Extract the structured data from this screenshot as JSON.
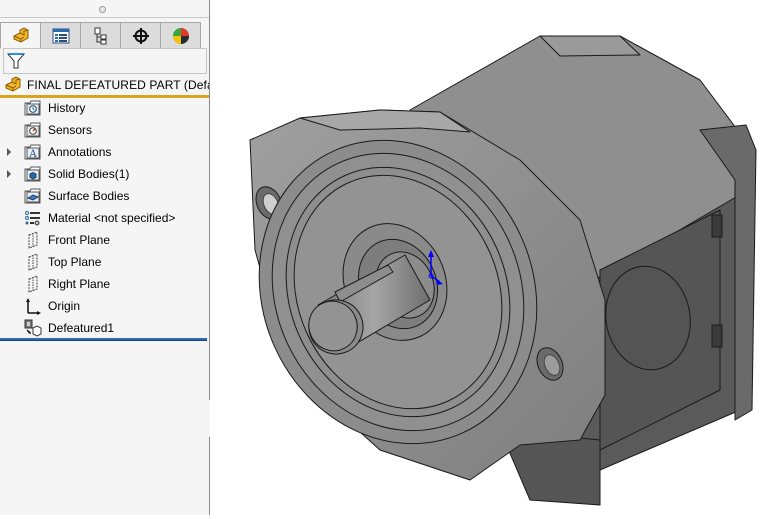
{
  "feature_manager": {
    "tabs": [
      {
        "name": "FeatureManager Design Tree",
        "icon": "part-icon",
        "active": true
      },
      {
        "name": "PropertyManager",
        "icon": "property-manager-icon",
        "active": false
      },
      {
        "name": "ConfigurationManager",
        "icon": "configuration-manager-icon",
        "active": false
      },
      {
        "name": "DimXpertManager",
        "icon": "dimxpert-icon",
        "active": false
      },
      {
        "name": "DisplayManager",
        "icon": "display-manager-icon",
        "active": false
      }
    ],
    "filter_icon": "filter-icon",
    "root": {
      "label": "FINAL DEFEATURED PART  (Default",
      "icon": "part-icon"
    },
    "tree": [
      {
        "label": "History",
        "icon": "history-folder-icon",
        "expandable": false
      },
      {
        "label": "Sensors",
        "icon": "sensors-folder-icon",
        "expandable": false
      },
      {
        "label": "Annotations",
        "icon": "annotations-folder-icon",
        "expandable": true
      },
      {
        "label": "Solid Bodies(1)",
        "icon": "solid-bodies-folder-icon",
        "expandable": true
      },
      {
        "label": "Surface Bodies",
        "icon": "surface-bodies-folder-icon",
        "expandable": false
      },
      {
        "label": "Material <not specified>",
        "icon": "material-icon",
        "expandable": false
      },
      {
        "label": "Front Plane",
        "icon": "plane-icon",
        "expandable": false
      },
      {
        "label": "Top Plane",
        "icon": "plane-icon",
        "expandable": false
      },
      {
        "label": "Right Plane",
        "icon": "plane-icon",
        "expandable": false
      },
      {
        "label": "Origin",
        "icon": "origin-icon",
        "expandable": false
      },
      {
        "label": "Defeatured1",
        "icon": "defeature-icon",
        "expandable": false
      }
    ]
  },
  "viewport": {
    "model": "gear-pump-defeatured-part",
    "triad_color": "#0000ff"
  },
  "colors": {
    "panel_bg": "#f5f5f5",
    "root_underline": "#d9a521",
    "rollback_bar": "#2f6bb5",
    "model_face": "#8c8c8c"
  }
}
